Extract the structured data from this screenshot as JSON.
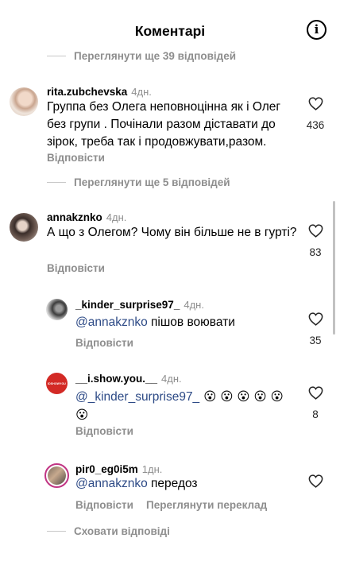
{
  "header": {
    "title": "Коментарі",
    "info_icon": "info-icon"
  },
  "view_more_1": "Переглянути ще 39 відповідей",
  "comments": [
    {
      "username": "rita.zubchevska",
      "time": "4дн.",
      "text": "Группа без Олега неповноцінна як і Олег без групи . Почінали разом діставати до зірок, треба так і продовжувати,разом.",
      "reply": "Відповісти",
      "likes": "436"
    },
    {
      "username": "annakznko",
      "time": "4дн.",
      "text": "А що з Олегом? Чому він більше не в гурті?",
      "reply": "Відповісти",
      "likes": "83"
    }
  ],
  "view_more_2": "Переглянути ще 5 відповідей",
  "replies": [
    {
      "username": "_kinder_surprise97_",
      "time": "4дн.",
      "mention": "@annakznko",
      "text": " пішов воювати",
      "reply": "Відповісти",
      "likes": "35"
    },
    {
      "username": "__i.show.you.__",
      "time": "4дн.",
      "mention": "@_kinder_surprise97_",
      "text": " 😮 😮 😮 😮 😮 😮",
      "reply": "Відповісти",
      "likes": "8",
      "avatar_label": "IDSHOWYOU"
    },
    {
      "username": "pir0_eg0i5m",
      "time": "1дн.",
      "mention": "@annakznko",
      "text": " передоз",
      "reply": "Відповісти",
      "translate": "Переглянути переклад",
      "likes": ""
    }
  ],
  "hide_replies": "Сховати відповіді",
  "colors": {
    "mention": "#2d4a86",
    "muted": "#8e8e8e",
    "avatar_red": "#d32a25"
  }
}
